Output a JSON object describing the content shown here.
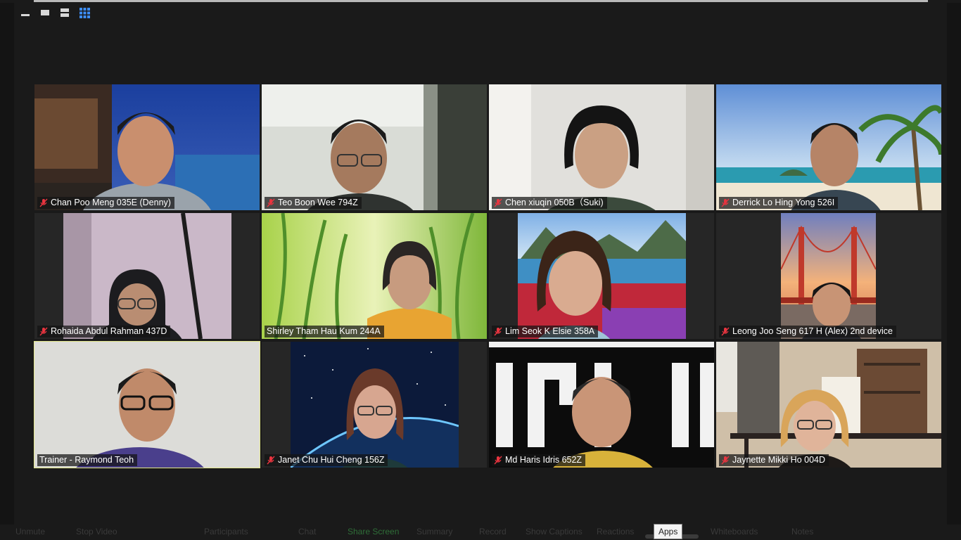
{
  "view_controls": [
    {
      "name": "minimize-view-button",
      "icon": "minus-icon"
    },
    {
      "name": "speaker-view-button",
      "icon": "single-window-icon"
    },
    {
      "name": "stacked-view-button",
      "icon": "stack-icon"
    },
    {
      "name": "gallery-view-button",
      "icon": "grid-icon",
      "active": true,
      "color": "#3d8df5"
    }
  ],
  "participants": [
    {
      "name": "Chan Poo Meng 035E (Denny)",
      "muted": true,
      "bg": "night-pool"
    },
    {
      "name": "Teo Boon Wee 794Z",
      "muted": true,
      "bg": "white-room"
    },
    {
      "name": "Chen xiuqin 050B（Suki)",
      "muted": true,
      "bg": "white-room"
    },
    {
      "name": "Derrick Lo Hing Yong 526I",
      "muted": true,
      "bg": "beach"
    },
    {
      "name": "Rohaida Abdul Rahman 437D",
      "muted": true,
      "bg": "lilac-wall"
    },
    {
      "name": "Shirley Tham Hau Kum 244A",
      "muted": false,
      "bg": "green-grass"
    },
    {
      "name": "Lim Seok K Elsie 358A",
      "muted": true,
      "bg": "lake-flowers"
    },
    {
      "name": "Leong Joo Seng 617 H (Alex) 2nd device",
      "muted": true,
      "bg": "golden-gate"
    },
    {
      "name": "Trainer - Raymond Teoh",
      "muted": false,
      "bg": "grey-wall",
      "active_speaker": true
    },
    {
      "name": "Janet Chu Hui Cheng 156Z",
      "muted": true,
      "bg": "space-earth"
    },
    {
      "name": "Md Haris Idris 652Z",
      "muted": true,
      "bg": "black-letters"
    },
    {
      "name": "Jaynette Mikki Ho 004D",
      "muted": true,
      "bg": "home-office"
    }
  ],
  "toolbar": {
    "tooltip": "Apps",
    "faded_labels": [
      "Unmute",
      "Stop Video",
      "Participants",
      "Chat",
      "Share Screen",
      "Summary",
      "Record",
      "Show Captions",
      "Reactions",
      "Whiteboards",
      "Notes"
    ]
  },
  "colors": {
    "background": "#1a1a1a",
    "tile": "#262626",
    "active_speaker_border": "#e3e88c",
    "muted_icon": "#e8343f"
  }
}
